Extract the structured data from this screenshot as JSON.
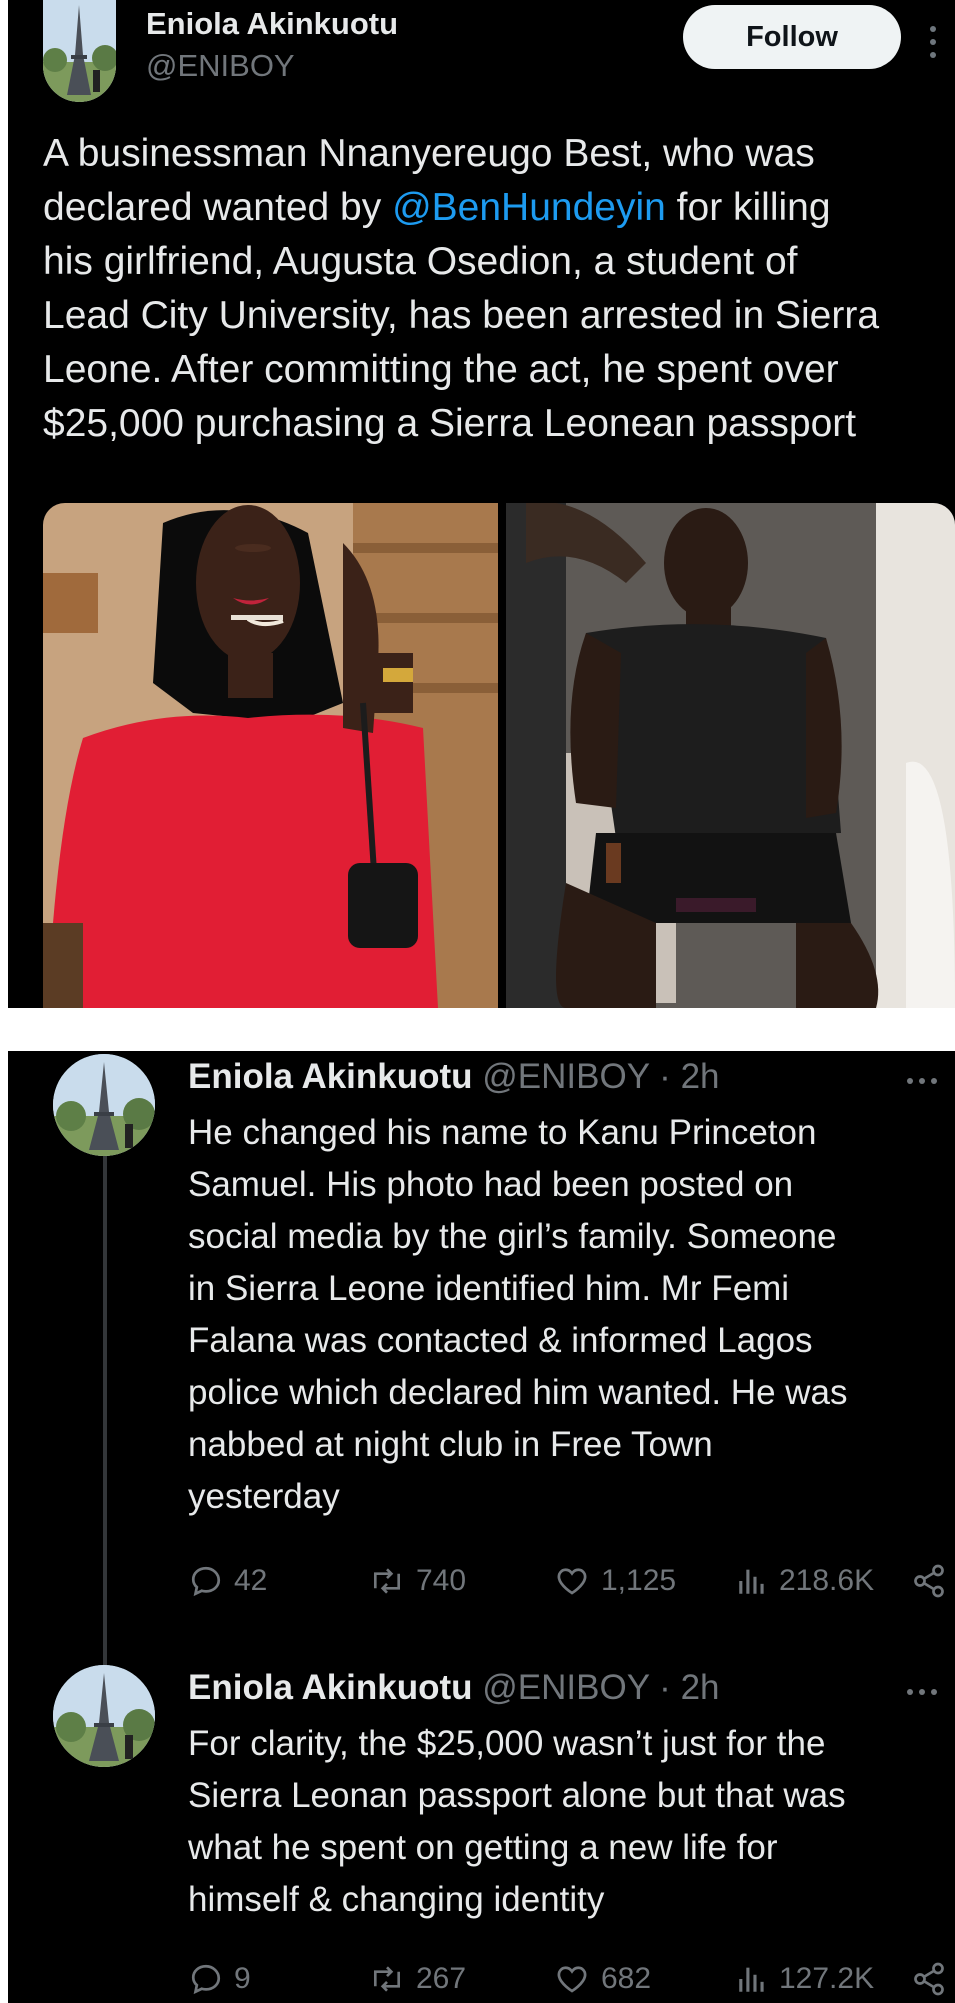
{
  "main_tweet": {
    "author_name": "Eniola Akinkuotu",
    "author_handle": "@ENIBOY",
    "follow_label": "Follow",
    "text_lines": [
      [
        "A businessman Nnanyereugo Best, who was"
      ],
      [
        "declared wanted by ",
        "@BenHundeyin",
        " for killing"
      ],
      [
        "his girlfriend, Augusta Osedion, a student of"
      ],
      [
        "Lead City University, has been arrested in Sierra"
      ],
      [
        "Leone. After committing the act, he spent over"
      ],
      [
        "$25,000 purchasing a Sierra Leonean passport"
      ]
    ],
    "media": [
      "woman-in-red-dress-photo",
      "handcuffed-man-photo"
    ]
  },
  "replies": [
    {
      "author_name": "Eniola Akinkuotu",
      "author_handle": "@ENIBOY",
      "separator": "·",
      "time": "2h",
      "text_lines": [
        "He changed his name to Kanu Princeton",
        "Samuel. His photo had been posted on",
        "social media by the girl’s family. Someone",
        "in Sierra Leone identified him. Mr Femi",
        "Falana was contacted & informed Lagos",
        "police which declared him wanted. He was",
        "nabbed at night club in Free Town",
        "yesterday"
      ],
      "stats": {
        "replies": "42",
        "reposts": "740",
        "likes": "1,125",
        "views": "218.6K"
      }
    },
    {
      "author_name": "Eniola Akinkuotu",
      "author_handle": "@ENIBOY",
      "separator": "·",
      "time": "2h",
      "text_lines": [
        "For clarity, the $25,000 wasn’t just for the",
        "Sierra Leonan passport alone but that was",
        "what he spent on getting a new life for",
        "himself & changing identity"
      ],
      "stats": {
        "replies": "9",
        "reposts": "267",
        "likes": "682",
        "views": "127.2K"
      }
    }
  ],
  "colors": {
    "background": "#000000",
    "text": "#e7e9ea",
    "muted": "#71767b",
    "link": "#1d9bf0",
    "follow_bg": "#eff3f4"
  }
}
